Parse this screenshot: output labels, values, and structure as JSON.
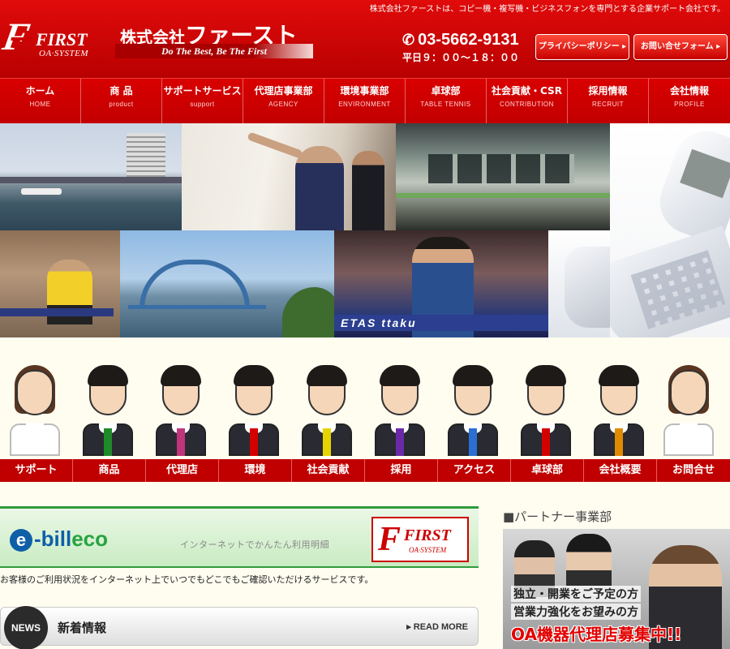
{
  "header": {
    "tagline": "株式会社ファーストは、コピー機・複写機・ビジネスフォンを専門とする企業サポート会社です。",
    "logo_first": "FIRST",
    "logo_oa": "OA·SYSTEM",
    "company_prefix": "株式会社",
    "company_name": "ファースト",
    "slogan": "Do The Best, Be The First",
    "phone": "03-5662-9131",
    "hours": "平日９：００～１８：００",
    "privacy_button": "プライバシーポリシー ▸",
    "contact_button": "お問い合せフォーム ▸"
  },
  "nav": {
    "items": [
      {
        "jp": "ホーム",
        "en": "HOME"
      },
      {
        "jp": "商 品",
        "en": "product"
      },
      {
        "jp": "サポートサービス",
        "en": "support"
      },
      {
        "jp": "代理店事業部",
        "en": "AGENCY"
      },
      {
        "jp": "環境事業部",
        "en": "ENVIRONMENT"
      },
      {
        "jp": "卓球部",
        "en": "TABLE TENNIS"
      },
      {
        "jp": "社会貢献・CSR",
        "en": "CONTRIBUTION"
      },
      {
        "jp": "採用情報",
        "en": "RECRUIT"
      },
      {
        "jp": "会社情報",
        "en": "PROFILE"
      }
    ]
  },
  "photos": {
    "ad_text": "ETAS  ttaku"
  },
  "staff_nav": {
    "items": [
      "サポート",
      "商品",
      "代理店",
      "環境",
      "社会貢献",
      "採用",
      "アクセス",
      "卓球部",
      "会社概要",
      "お問合せ"
    ]
  },
  "ebill": {
    "logo_e": "e",
    "logo_bill": "-bill",
    "logo_eco": "eco",
    "text": "インターネットでかんたん利用明細",
    "first_mark": "F",
    "first_name": "FIRST",
    "first_sub": "OA·SYSTEM",
    "description": "お客様のご利用状況をインターネット上でいつでもどこでもご確認いただけるサービスです。"
  },
  "news": {
    "badge": "NEWS",
    "title": "新着情報",
    "more": "▸ READ MORE"
  },
  "partner": {
    "heading": "■パートナー事業部",
    "line1": "独立・開業をご予定の方",
    "line2": "営業力強化をお望みの方",
    "cta": "OA機器代理店募集中!!"
  },
  "colors": {
    "brand_red": "#cc0000",
    "ebill_green": "#2f9a3c",
    "background": "#fffdf0"
  }
}
